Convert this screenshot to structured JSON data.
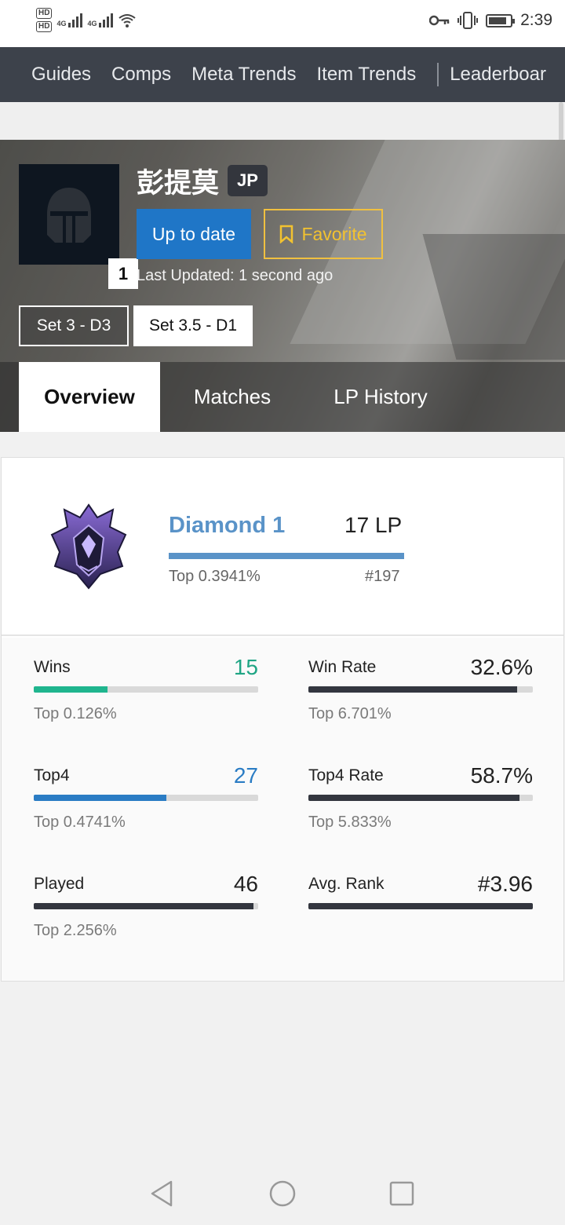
{
  "status_bar": {
    "hd1": "HD",
    "hd2": "HD",
    "net1": "4G",
    "net2": "4G",
    "time": "2:39",
    "icons": [
      "key-icon",
      "vibrate-icon",
      "battery-icon",
      "wifi-icon",
      "signal-icon"
    ]
  },
  "nav": {
    "items": [
      "Guides",
      "Comps",
      "Meta Trends",
      "Item Trends"
    ],
    "overflow_item": "Leaderboar"
  },
  "profile": {
    "name": "彭提莫",
    "region": "JP",
    "level": "1",
    "update_button": "Up to date",
    "favorite_button": "Favorite",
    "last_updated": "Last Updated: 1 second ago",
    "sets": [
      "Set 3 - D3",
      "Set 3.5 - D1"
    ],
    "tabs": [
      "Overview",
      "Matches",
      "LP History"
    ]
  },
  "rank": {
    "tier": "Diamond 1",
    "lp": "17 LP",
    "top": "Top 0.3941%",
    "position": "#197",
    "colors": {
      "tier": "#5a93c8"
    }
  },
  "stats": [
    {
      "label": "Wins",
      "value": "15",
      "sub": "Top 0.126%",
      "fill": 0.33
    },
    {
      "label": "Win Rate",
      "value": "32.6%",
      "sub": "Top 6.701%",
      "fill": 0.93
    },
    {
      "label": "Top4",
      "value": "27",
      "sub": "Top 0.4741%",
      "fill": 0.59
    },
    {
      "label": "Top4 Rate",
      "value": "58.7%",
      "sub": "Top 5.833%",
      "fill": 0.94
    },
    {
      "label": "Played",
      "value": "46",
      "sub": "Top 2.256%",
      "fill": 0.98
    },
    {
      "label": "Avg. Rank",
      "value": "#3.96",
      "sub": "",
      "fill": 1.0
    }
  ],
  "colors": {
    "nav_bg": "#3d424b",
    "update_btn": "#1f76c7",
    "favorite": "#f2c230",
    "wins_green": "#1fa584",
    "top4_blue": "#2a7cc4"
  }
}
